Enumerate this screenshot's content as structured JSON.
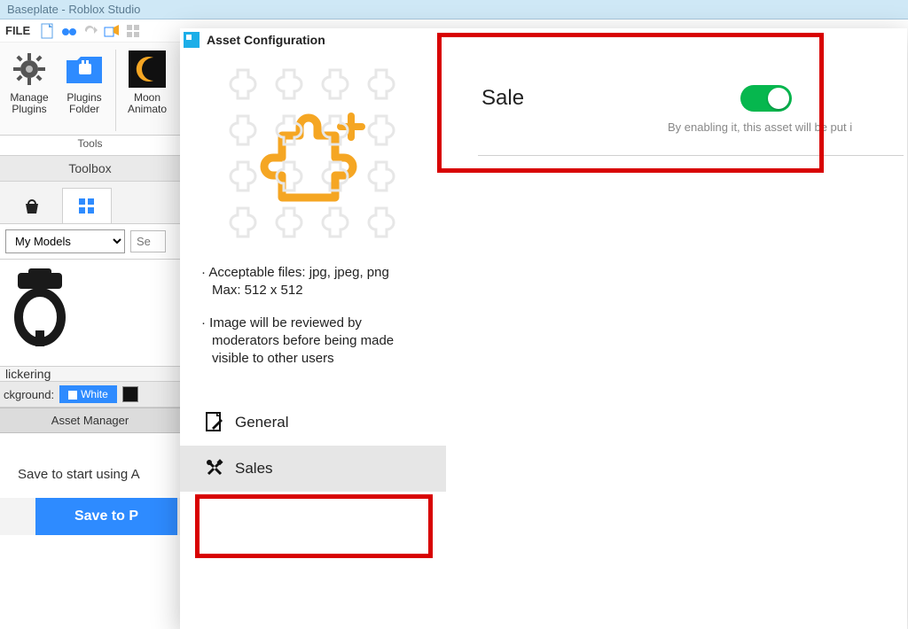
{
  "window": {
    "title": "Baseplate - Roblox Studio"
  },
  "menu": {
    "file": "FILE"
  },
  "ribbon": {
    "items": [
      {
        "line1": "Manage",
        "line2": "Plugins"
      },
      {
        "line1": "Plugins",
        "line2": "Folder"
      },
      {
        "line1": "Moon",
        "line2": "Animato"
      }
    ],
    "group_caption": "Tools"
  },
  "toolbox": {
    "title": "Toolbox",
    "category": "My Models",
    "search_placeholder": "Se",
    "item_name": "lickering",
    "background_label": "ckground:",
    "white_label": "White"
  },
  "asset_manager": {
    "tab": "Asset Manager",
    "save_msg": "Save to start using A",
    "button": "Save to P"
  },
  "modal": {
    "title": "Asset Configuration",
    "hint1": "Acceptable files: jpg, jpeg, png",
    "hint1b": "Max: 512 x 512",
    "hint2": "Image will be reviewed by moderators before being made visible to other users",
    "nav_general": "General",
    "nav_sales": "Sales",
    "sale_label": "Sale",
    "sale_hint": "By enabling it, this asset will be put i"
  }
}
